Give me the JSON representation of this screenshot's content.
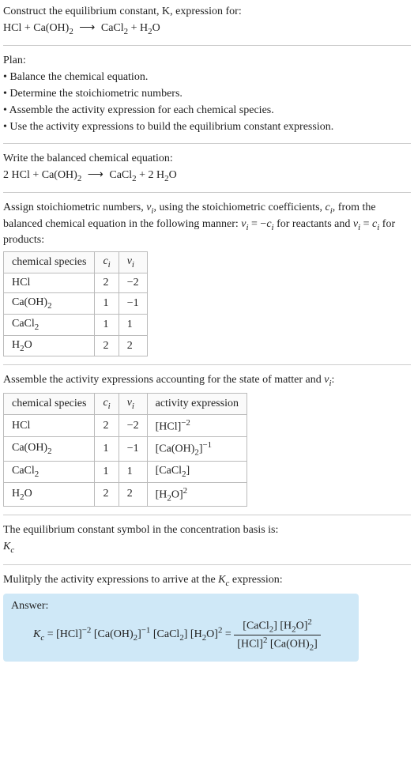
{
  "header": {
    "construct_line": "Construct the equilibrium constant, K, expression for:",
    "unbalanced_eq": "HCl + Ca(OH)₂ ⟶ CaCl₂ + H₂O"
  },
  "plan": {
    "title": "Plan:",
    "step1": "• Balance the chemical equation.",
    "step2": "• Determine the stoichiometric numbers.",
    "step3": "• Assemble the activity expression for each chemical species.",
    "step4": "• Use the activity expressions to build the equilibrium constant expression."
  },
  "balanced": {
    "intro": "Write the balanced chemical equation:",
    "eq": "2 HCl + Ca(OH)₂ ⟶ CaCl₂ + 2 H₂O"
  },
  "stoich": {
    "intro_part1": "Assign stoichiometric numbers, ",
    "intro_part2": ", using the stoichiometric coefficients, ",
    "intro_part3": ", from the balanced chemical equation in the following manner: ",
    "intro_part4": " for reactants and ",
    "intro_part5": " for products:",
    "nu_sym": "νᵢ",
    "c_sym": "cᵢ",
    "rel_react": "νᵢ = −cᵢ",
    "rel_prod": "νᵢ = cᵢ",
    "h_species": "chemical species",
    "h_c": "cᵢ",
    "h_nu": "νᵢ",
    "rows": [
      {
        "sp": "HCl",
        "c": "2",
        "nu": "−2"
      },
      {
        "sp": "Ca(OH)₂",
        "c": "1",
        "nu": "−1"
      },
      {
        "sp": "CaCl₂",
        "c": "1",
        "nu": "1"
      },
      {
        "sp": "H₂O",
        "c": "2",
        "nu": "2"
      }
    ]
  },
  "activity": {
    "intro": "Assemble the activity expressions accounting for the state of matter and νᵢ:",
    "h_species": "chemical species",
    "h_c": "cᵢ",
    "h_nu": "νᵢ",
    "h_act": "activity expression",
    "rows": [
      {
        "sp": "HCl",
        "c": "2",
        "nu": "−2",
        "act_html": "[HCl]<sup>−2</sup>"
      },
      {
        "sp": "Ca(OH)₂",
        "c": "1",
        "nu": "−1",
        "act_html": "[Ca(OH)<sub>2</sub>]<sup>−1</sup>"
      },
      {
        "sp": "CaCl₂",
        "c": "1",
        "nu": "1",
        "act_html": "[CaCl<sub>2</sub>]"
      },
      {
        "sp": "H₂O",
        "c": "2",
        "nu": "2",
        "act_html": "[H<sub>2</sub>O]<sup>2</sup>"
      }
    ]
  },
  "kc_symbol": {
    "intro": "The equilibrium constant symbol in the concentration basis is:",
    "sym": "K",
    "sub": "c"
  },
  "multiply": {
    "intro_pre": "Mulitply the activity expressions to arrive at the ",
    "intro_post": " expression:",
    "kc": "K",
    "kc_sub": "c"
  },
  "answer": {
    "label": "Answer:",
    "lhs_html": "<span class=\"ital\">K<sub>c</sub></span> = [HCl]<sup>−2</sup> [Ca(OH)<sub>2</sub>]<sup>−1</sup> [CaCl<sub>2</sub>] [H<sub>2</sub>O]<sup>2</sup> = ",
    "num_html": "[CaCl<sub>2</sub>] [H<sub>2</sub>O]<sup>2</sup>",
    "den_html": "[HCl]<sup>2</sup> [Ca(OH)<sub>2</sub>]"
  }
}
